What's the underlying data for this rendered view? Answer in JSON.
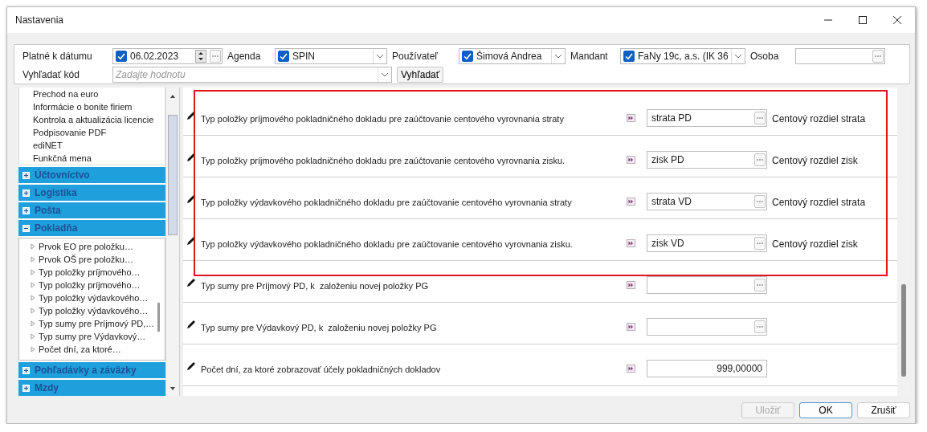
{
  "window": {
    "title": "Nastavenia"
  },
  "filters": [
    {
      "label": "Platné k dátumu",
      "kind": "date",
      "value": "06.02.2023",
      "checked": true
    },
    {
      "label": "Agenda",
      "kind": "combo",
      "value": "SPIN",
      "checked": true
    },
    {
      "label": "Používateľ",
      "kind": "combo",
      "value": "Šimová Andrea",
      "checked": true
    },
    {
      "label": "Mandant",
      "kind": "combo",
      "value": "FaNy 19c, a.s. (IK 36",
      "checked": true
    },
    {
      "label": "Osoba",
      "kind": "lookup"
    }
  ],
  "search": {
    "label": "Vyhľadať kód",
    "placeholder": "Zadajte hodnotu",
    "button": "Vyhľadať"
  },
  "sidebar": {
    "items": [
      "Prechod na euro",
      "Informácie o bonite firiem",
      "Kontrola a aktualizácia licencie",
      "Podpisovanie PDF",
      "ediNET",
      "Funkčná mena"
    ],
    "groups": [
      {
        "label": "Účtovníctvo",
        "expanded": false
      },
      {
        "label": "Logistika",
        "expanded": false
      },
      {
        "label": "Pošta",
        "expanded": false
      },
      {
        "label": "Pokladňa",
        "expanded": true,
        "children": [
          "Prvok EO pre položku…",
          "Prvok OŠ pre položku…",
          "Typ položky príjmového…",
          "Typ položky príjmového…",
          "Typ položky výdavkového…",
          "Typ položky výdavkového…",
          "Typ sumy pre Príjmový PD,…",
          "Typ sumy pre Výdavkový…",
          "Počet dní, za ktoré…"
        ]
      },
      {
        "label": "Pohľadávky a záväzky",
        "expanded": false
      },
      {
        "label": "Mzdy",
        "expanded": false
      }
    ]
  },
  "settings": {
    "rows": [
      {
        "kind": "lookup",
        "text": "Typ položky príjmového pokladničného dokladu pre zaúčtovanie centového vyrovnania straty",
        "value": "strata PD",
        "description": "Centový rozdiel strata",
        "highlighted": true
      },
      {
        "kind": "lookup",
        "text": "Typ položky príjmového pokladničného dokladu pre zaúčtovanie centového vyrovnania zisku.",
        "value": "zisk PD",
        "description": "Centový rozdiel zisk",
        "highlighted": true
      },
      {
        "kind": "lookup",
        "text": "Typ položky výdavkového pokladničného dokladu pre zaúčtovanie centového vyrovnania straty",
        "value": "strata VD",
        "description": "Centový rozdiel strata",
        "highlighted": true
      },
      {
        "kind": "lookup",
        "text": "Typ položky výdavkového pokladničného dokladu pre zaúčtovanie centového vyrovnania zisku.",
        "value": "zisk VD",
        "description": "Centový rozdiel zisk",
        "highlighted": true
      },
      {
        "kind": "lookup",
        "text": "Typ sumy pre Príjmový PD, k  založeniu novej položky PG",
        "highlighted": false
      },
      {
        "kind": "lookup",
        "text": "Typ sumy pre Výdavkový PD, k  založeniu novej položky PG",
        "highlighted": false
      },
      {
        "kind": "number",
        "text": "Počet dní, za ktoré zobrazovať účely pokladničných dokladov",
        "value": "999,00000",
        "highlighted": false
      }
    ]
  },
  "buttons": [
    {
      "label": "Uložiť",
      "disabled": true,
      "default": false
    },
    {
      "label": "OK",
      "disabled": false,
      "default": true
    },
    {
      "label": "Zrušiť",
      "disabled": false,
      "default": false
    }
  ]
}
